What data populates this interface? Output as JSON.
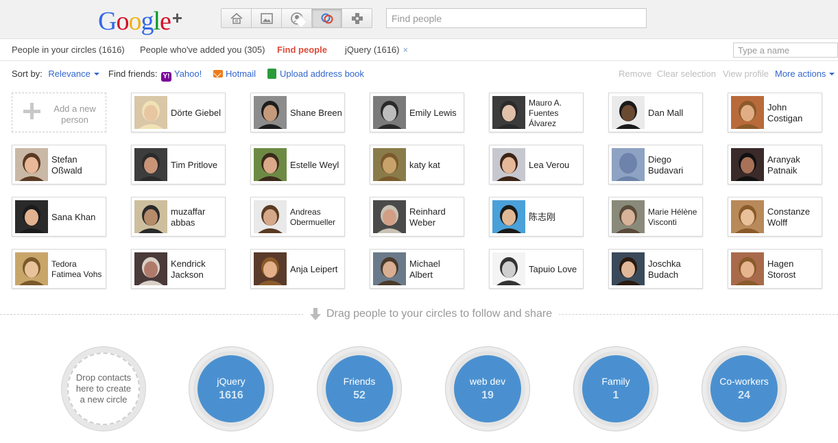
{
  "header": {
    "logo_text": "Google",
    "logo_plus": "+",
    "nav_icons": [
      "home-icon",
      "photos-icon",
      "profile-icon",
      "circles-icon",
      "games-icon"
    ],
    "search_placeholder": "Find people"
  },
  "tabs": [
    {
      "label": "People in your circles (1616)"
    },
    {
      "label": "People who've added you (305)"
    },
    {
      "label": "Find people"
    },
    {
      "label": "jQuery (1616)",
      "close": "×"
    }
  ],
  "name_filter_placeholder": "Type a name",
  "toolbar": {
    "sort_label": "Sort by:",
    "sort_value": "Relevance",
    "find_friends_label": "Find friends:",
    "yahoo": "Yahoo!",
    "hotmail": "Hotmail",
    "upload": "Upload address book",
    "remove": "Remove",
    "clear_selection": "Clear selection",
    "view_profile": "View profile",
    "more_actions": "More actions"
  },
  "add_person": "Add a new person",
  "people": [
    {
      "name": "Dörte Giebel",
      "bg": "#d9c7a8",
      "face": "#e9c6a2",
      "hair": "#f0e2b6"
    },
    {
      "name": "Shane Breen",
      "bg": "#8c8c8c",
      "face": "#c49a7a",
      "hair": "#1d1d1d"
    },
    {
      "name": "Emily Lewis",
      "bg": "#7a7a7a",
      "face": "#bdbdbd",
      "hair": "#2a2a2a"
    },
    {
      "name": "Mauro A. Fuentes Álvarez",
      "bg": "#3b3b3b",
      "face": "#e1c0a9",
      "hair": "#2a2a2a"
    },
    {
      "name": "Dan Mall",
      "bg": "#eaeaea",
      "face": "#6b4a32",
      "hair": "#1a1a1a"
    },
    {
      "name": "John Costigan",
      "bg": "#b96a3a",
      "face": "#e0ad85",
      "hair": "#8c5a2a"
    },
    {
      "name": "Stefan Oßwald",
      "bg": "#c9b8a5",
      "face": "#e8b898",
      "hair": "#5a3a22"
    },
    {
      "name": "Tim Pritlove",
      "bg": "#3d3d3d",
      "face": "#c89478",
      "hair": "#2b2b2b"
    },
    {
      "name": "Estelle Weyl",
      "bg": "#6d8a44",
      "face": "#d9a98a",
      "hair": "#3a2a1a"
    },
    {
      "name": "katy kat",
      "bg": "#8a7b4a",
      "face": "#c7a36b",
      "hair": "#7b5a2d"
    },
    {
      "name": "Lea Verou",
      "bg": "#c7c7cf",
      "face": "#e5b89a",
      "hair": "#3c2416"
    },
    {
      "name": "Diego Budavari",
      "bg": "#8ea2c3",
      "face": "#6d83ab",
      "hair": "#6d83ab"
    },
    {
      "name": "Aranyak Patnaik",
      "bg": "#3a2a2a",
      "face": "#a87158",
      "hair": "#111"
    },
    {
      "name": "Sana Khan",
      "bg": "#2a2a2a",
      "face": "#e3b290",
      "hair": "#1b1b1b"
    },
    {
      "name": "muzaffar abbas",
      "bg": "#cdbf9e",
      "face": "#b68b6a",
      "hair": "#2a2a2a"
    },
    {
      "name": "Andreas Obermueller",
      "bg": "#e9e9e9",
      "face": "#d6a88a",
      "hair": "#5a3a22"
    },
    {
      "name": "Reinhard Weber",
      "bg": "#4a4a4a",
      "face": "#d39e86",
      "hair": "#c9c2b5"
    },
    {
      "name": "陈志刚",
      "bg": "#4aa0d8",
      "face": "#e0b896",
      "hair": "#1a1a1a"
    },
    {
      "name": "Marie Hélène Visconti",
      "bg": "#8a8a7a",
      "face": "#d7b39a",
      "hair": "#5a4a3a"
    },
    {
      "name": "Constanze Wolff",
      "bg": "#b88a5a",
      "face": "#e8c09a",
      "hair": "#8a5a2a"
    },
    {
      "name": "Tedora Fatimea Vohs",
      "bg": "#c8a66a",
      "face": "#e7c29a",
      "hair": "#7a5a2a"
    },
    {
      "name": "Kendrick Jackson",
      "bg": "#4a3a3a",
      "face": "#b07a6a",
      "hair": "#d9d0c8"
    },
    {
      "name": "Anja Leipert",
      "bg": "#5a3a2a",
      "face": "#e3b08a",
      "hair": "#8a5a2a"
    },
    {
      "name": "Michael Albert",
      "bg": "#6a7a8a",
      "face": "#d9ae92",
      "hair": "#4a3a2a"
    },
    {
      "name": "Tapuio Love",
      "bg": "#f4f4f4",
      "face": "#cfcfcf",
      "hair": "#333"
    },
    {
      "name": "Joschka Budach",
      "bg": "#3a4a5a",
      "face": "#e1b79a",
      "hair": "#2a1a10"
    },
    {
      "name": "Hagen Storost",
      "bg": "#a86a4a",
      "face": "#e6b48e",
      "hair": "#8a5a2a"
    }
  ],
  "drag_message": "Drag people to your circles to follow and share",
  "drop_circle": "Drop contacts here to create a new circle",
  "circles": [
    {
      "name": "jQuery",
      "count": "1616"
    },
    {
      "name": "Friends",
      "count": "52"
    },
    {
      "name": "web dev",
      "count": "19"
    },
    {
      "name": "Family",
      "count": "1"
    },
    {
      "name": "Co-workers",
      "count": "24"
    }
  ],
  "colors": {
    "accent_red": "#dd4b39",
    "link_blue": "#3366cc",
    "circle_blue": "#4a90d0"
  }
}
